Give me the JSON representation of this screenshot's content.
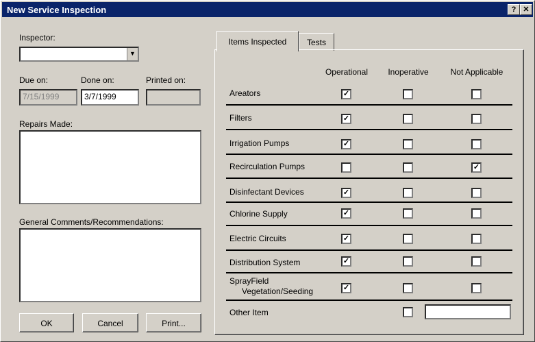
{
  "window": {
    "title": "New Service Inspection",
    "help_label": "?",
    "close_label": "✕"
  },
  "left": {
    "inspector_label": "Inspector:",
    "inspector_value": "",
    "due_label": "Due on:",
    "due_value": "7/15/1999",
    "done_label": "Done on:",
    "done_value": "3/7/1999",
    "printed_label": "Printed on:",
    "printed_value": "",
    "repairs_label": "Repairs Made:",
    "repairs_value": "",
    "comments_label": "General Comments/Recommendations:",
    "comments_value": ""
  },
  "buttons": {
    "ok": "OK",
    "cancel": "Cancel",
    "print": "Print..."
  },
  "tabs": [
    {
      "label": "Items Inspected"
    },
    {
      "label": "Tests"
    }
  ],
  "columns": [
    "Operational",
    "Inoperative",
    "Not Applicable"
  ],
  "items": [
    {
      "label": "Areators",
      "checked": [
        true,
        false,
        false
      ]
    },
    {
      "label": "Filters",
      "checked": [
        true,
        false,
        false
      ]
    },
    {
      "label": "Irrigation Pumps",
      "checked": [
        true,
        false,
        false
      ]
    },
    {
      "label": "Recirculation Pumps",
      "checked": [
        false,
        false,
        true
      ]
    },
    {
      "label": "Disinfectant Devices",
      "checked": [
        true,
        false,
        false
      ]
    },
    {
      "label": "Chlorine Supply",
      "checked": [
        true,
        false,
        false
      ]
    },
    {
      "label": "Electric Circuits",
      "checked": [
        true,
        false,
        false
      ]
    },
    {
      "label": "Distribution System",
      "checked": [
        true,
        false,
        false
      ]
    },
    {
      "label": "SprayField",
      "label2": "Vegetation/Seeding",
      "checked": [
        true,
        false,
        false
      ]
    }
  ],
  "other_item": {
    "label": "Other Item",
    "checked": false,
    "value": ""
  }
}
